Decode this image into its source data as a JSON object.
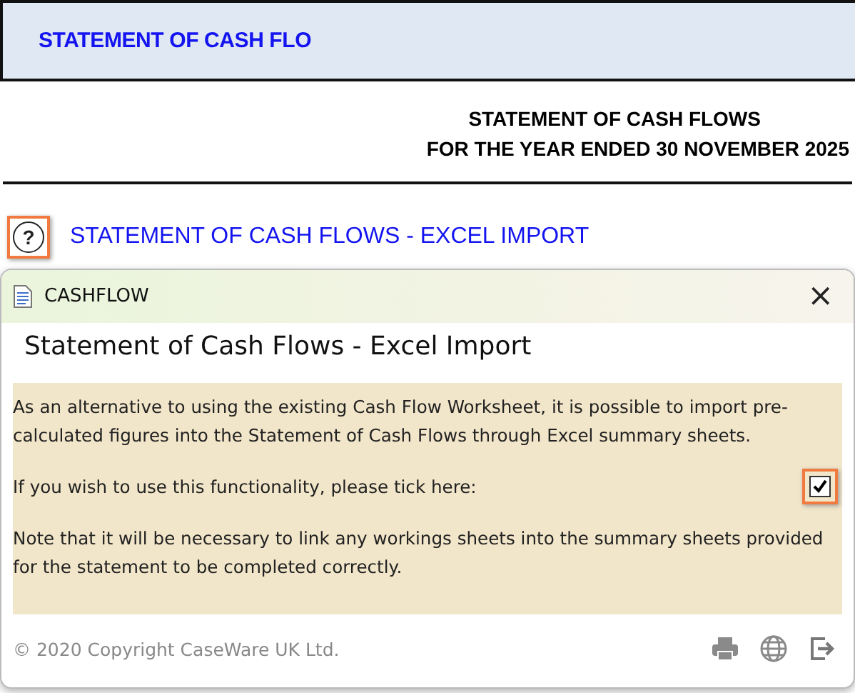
{
  "banner": {
    "title": "STATEMENT OF CASH FLO"
  },
  "heading": {
    "lines": [
      "STATEMENT OF CASH FLOWS",
      "FOR THE YEAR ENDED 30 NOVEMBER 2025"
    ]
  },
  "help_link": {
    "icon": "?",
    "label": "STATEMENT OF CASH FLOWS - EXCEL IMPORT"
  },
  "dialog": {
    "title": "CASHFLOW",
    "close": "×",
    "heading": "Statement of Cash Flows - Excel Import",
    "paragraphs": [
      {
        "kind": "text",
        "text": "As an alternative to using the existing Cash Flow Worksheet, it is possible to import pre-calculated figures into the Statement of Cash Flows through Excel summary sheets."
      },
      {
        "kind": "checkbox",
        "text": "If you wish to use this functionality, please tick here:",
        "checked": true
      },
      {
        "kind": "text",
        "text": "Note that it will be necessary to link any workings sheets into the summary sheets provided for the statement to be completed correctly."
      }
    ],
    "copyright": "© 2020 Copyright CaseWare UK Ltd."
  }
}
